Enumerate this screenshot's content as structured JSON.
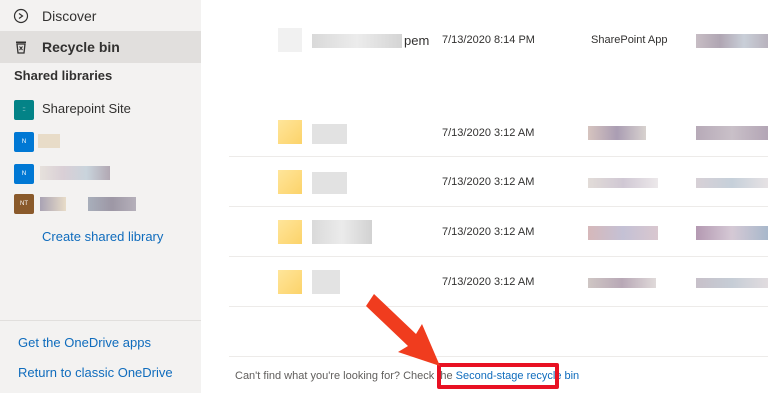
{
  "sidebar": {
    "nav": [
      {
        "label": "Discover",
        "icon": "discover-icon"
      },
      {
        "label": "Recycle bin",
        "icon": "recycle-bin-icon",
        "active": true
      }
    ],
    "shared_libraries_heading": "Shared libraries",
    "libraries": [
      {
        "badge": "::",
        "label": "Sharepoint Site",
        "color": "#038387"
      },
      {
        "badge": "N",
        "label": "",
        "color": "#0078d4"
      },
      {
        "badge": "N",
        "label": "",
        "color": "#0078d4"
      },
      {
        "badge": "NT",
        "label": "",
        "color": "#8a5a2b"
      }
    ],
    "create_library": "Create shared library",
    "get_apps": "Get the OneDrive apps",
    "classic": "Return to classic OneDrive"
  },
  "files": [
    {
      "name_tail": "pem",
      "date": "7/13/2020 8:14 PM",
      "app": "SharePoint App"
    },
    {
      "date": "7/13/2020 3:12 AM",
      "app": ""
    },
    {
      "date": "7/13/2020 3:12 AM",
      "app": ""
    },
    {
      "date": "7/13/2020 3:12 AM",
      "app": ""
    },
    {
      "date": "7/13/2020 3:12 AM",
      "app": ""
    }
  ],
  "footer": {
    "prompt": "Can't find what you're looking for? Check the ",
    "link": "Second-stage recycle bin"
  },
  "colors": {
    "accent": "#0f6cbd",
    "highlight": "#e81123",
    "arrow": "#f03c1e"
  }
}
